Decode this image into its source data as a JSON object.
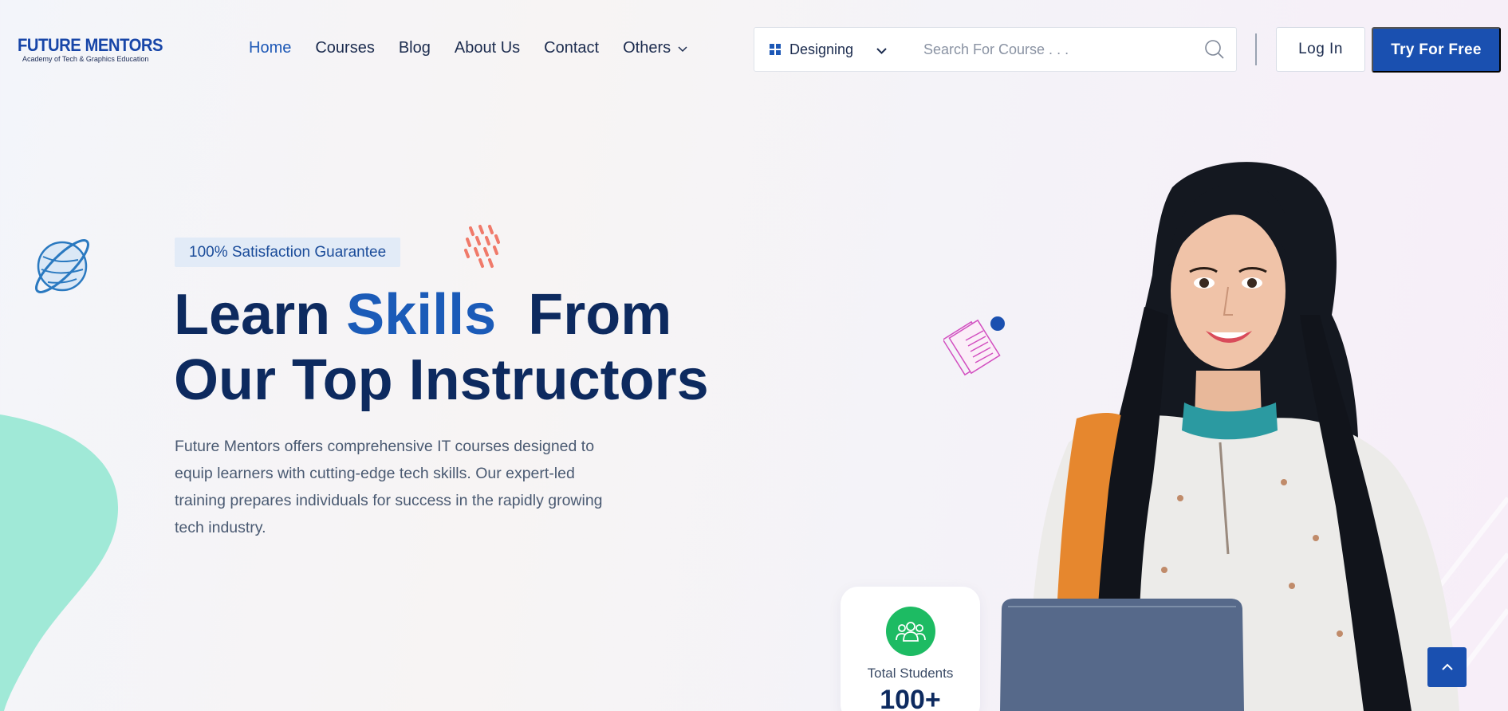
{
  "brand": {
    "name": "FUTURE MENTORS",
    "tagline": "Academy of Tech & Graphics Education"
  },
  "nav": {
    "items": [
      {
        "label": "Home",
        "active": true
      },
      {
        "label": "Courses"
      },
      {
        "label": "Blog"
      },
      {
        "label": "About Us"
      },
      {
        "label": "Contact"
      },
      {
        "label": "Others",
        "has_dropdown": true
      }
    ]
  },
  "search": {
    "category": "Designing",
    "placeholder": "Search For Course . . ."
  },
  "auth": {
    "login_label": "Log In",
    "cta_label": "Try For Free"
  },
  "hero": {
    "badge": "100% Satisfaction Guarantee",
    "headline_part1": "Learn ",
    "headline_highlight": "Skills",
    "headline_part2": "  From",
    "headline_line2": "Our Top Instructors",
    "description": "Future Mentors offers comprehensive IT courses designed to equip learners with cutting-edge tech skills. Our expert-led training prepares individuals for success in the rapidly growing tech industry."
  },
  "stats": {
    "label": "Total Students",
    "value": "100+"
  },
  "colors": {
    "primary": "#1a50b0",
    "heading": "#0d2a5f",
    "highlight": "#1b5bb8",
    "success": "#1dbb63",
    "blob": "#9ee8d6"
  },
  "icons": {
    "category": "grid-icon",
    "search": "search-icon",
    "dropdown": "chevron-down-icon",
    "stats": "users-group-icon",
    "scroll_top": "chevron-up-icon"
  }
}
